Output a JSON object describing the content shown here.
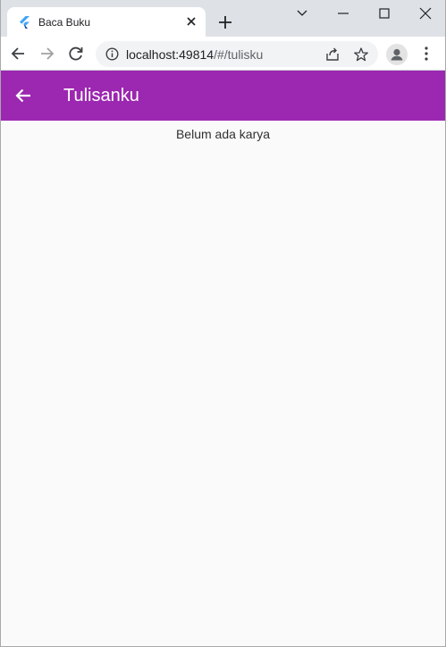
{
  "browser": {
    "tab": {
      "title": "Baca Buku",
      "favicon": "flutter-logo-icon"
    },
    "url_host": "localhost:49814",
    "url_path": "/#/tulisku"
  },
  "appbar": {
    "title": "Tulisanku",
    "color": "#9c27b0"
  },
  "content": {
    "empty_message": "Belum ada karya"
  }
}
